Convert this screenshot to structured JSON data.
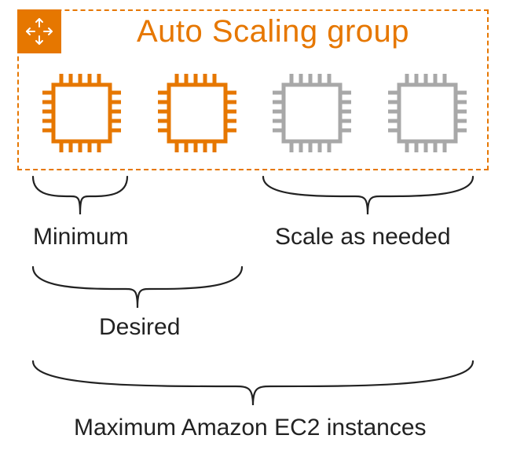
{
  "asg": {
    "title": "Auto Scaling group",
    "badge_icon": "scale-arrows-icon"
  },
  "instances": [
    {
      "state": "active"
    },
    {
      "state": "active"
    },
    {
      "state": "idle"
    },
    {
      "state": "idle"
    }
  ],
  "labels": {
    "minimum": "Minimum",
    "scale_as_needed": "Scale as needed",
    "desired": "Desired",
    "maximum": "Maximum Amazon EC2 instances"
  },
  "colors": {
    "accent": "#e67700",
    "idle": "#a8a8a8",
    "ink": "#222222"
  }
}
